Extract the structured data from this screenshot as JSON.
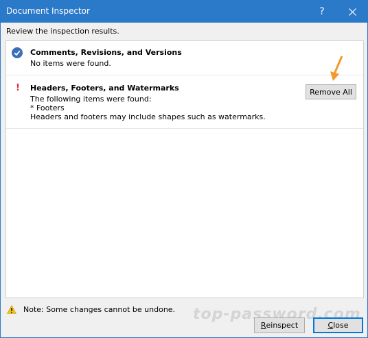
{
  "window": {
    "title": "Document Inspector",
    "help_label": "?",
    "accent_color": "#2b79c9"
  },
  "instructions": "Review the inspection results.",
  "sections": [
    {
      "status_icon": "check-circle-icon",
      "title": "Comments, Revisions, and Versions",
      "lines": [
        "No items were found."
      ]
    },
    {
      "status_icon": "exclamation-icon",
      "title": "Headers, Footers, and Watermarks",
      "lines": [
        "The following items were found:",
        "* Footers",
        "Headers and footers may include shapes such as watermarks."
      ],
      "action_label": "Remove All"
    }
  ],
  "note": "Note: Some changes cannot be undone.",
  "watermark": "top-password.com",
  "buttons": {
    "reinspect_first": "R",
    "reinspect_rest": "einspect",
    "close_first": "C",
    "close_rest": "lose"
  }
}
